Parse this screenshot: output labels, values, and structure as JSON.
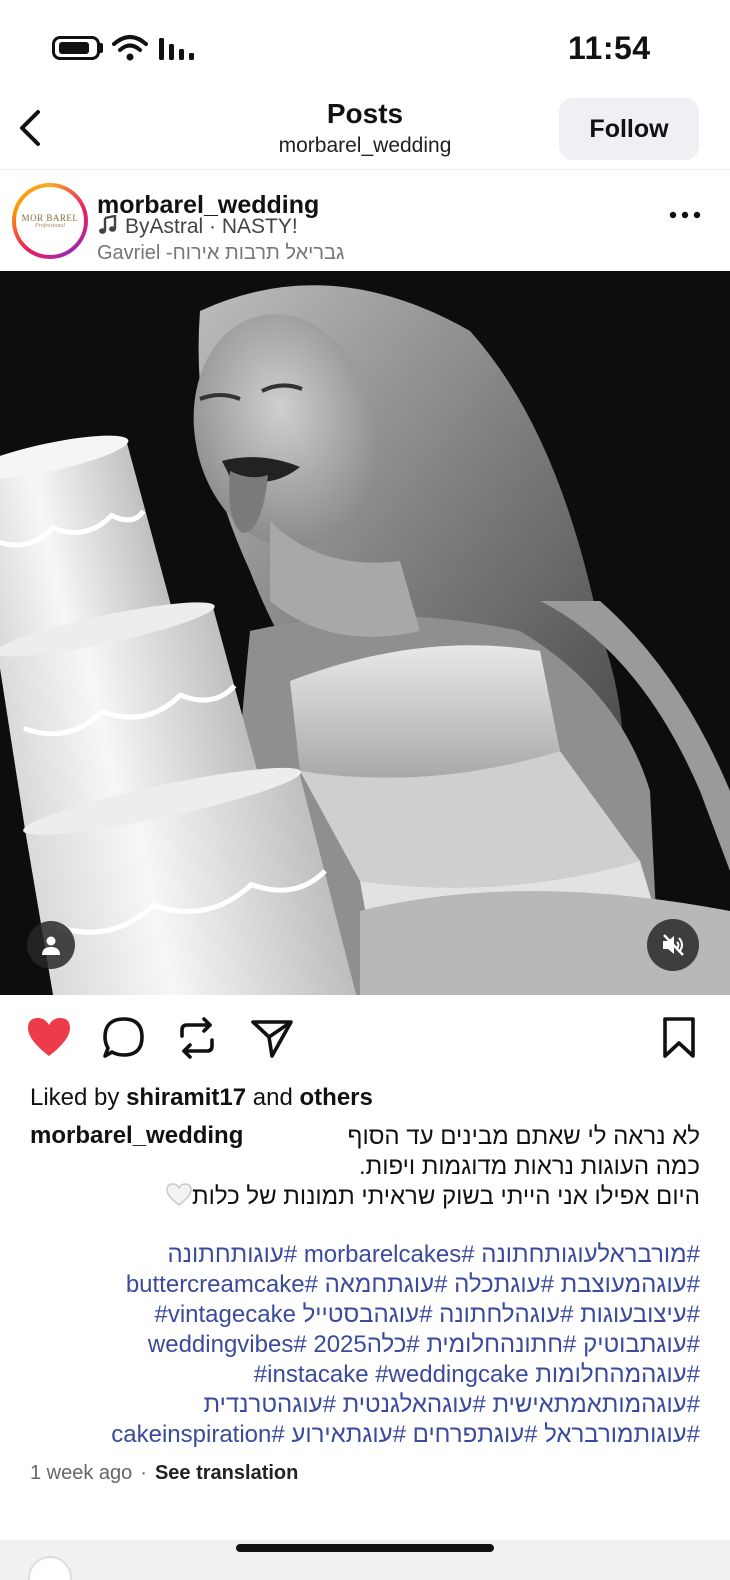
{
  "status_bar": {
    "time": "11:54"
  },
  "nav": {
    "title": "Posts",
    "subtitle": "morbarel_wedding",
    "follow_label": "Follow"
  },
  "post": {
    "username": "morbarel_wedding",
    "avatar_text": "MOR BAREL",
    "avatar_subtext": "Professional",
    "audio": "ByAstral · NASTY!",
    "location": "Gavriel -גבריאל תרבות אירוח"
  },
  "actions": {
    "liked": true,
    "like_color": "#ed3b4c"
  },
  "likes": {
    "prefix": "Liked by",
    "user": "shiramit17",
    "and": "and",
    "others": "others"
  },
  "caption": {
    "user": "morbarel_wedding",
    "lines": [
      "לא נראה לי שאתם מבינים עד הסוף",
      "כמה העוגות נראות מדוגמות ויפות.",
      "היום אפילו אני הייתי בשוק שראיתי תמונות של כלות"
    ]
  },
  "hashtags": [
    "#מורבראלעוגותחתונה #morbarelcakes #עוגותחתונה",
    "#עוגהמעוצבת #עוגתכלה #עוגתחמאה #buttercreamcake",
    "#עוגתבוטיק #חתונהחלומית #כלה2025 #weddingvibes",
    "#עוגהמותאמתאישית #עוגהאלגנטית #עוגהטרנדית",
    "#עוגותמורבראל #עוגתפרחים #עוגתאירוע #cakeinspiration"
  ],
  "hashtags_mixed": {
    "line3": {
      "a": "#עיצובעוגות #עוגהלחתונה #עוגהבסטייל",
      "b": "#vintagecake"
    },
    "line5": {
      "a": "#עוגהמהחלומות",
      "b": "#instacake #weddingcake"
    }
  },
  "meta": {
    "age": "1 week ago",
    "separator": "·",
    "translate": "See translation"
  },
  "colors": {
    "hashtag": "#3b4a9c",
    "follow_bg": "#efeff4"
  }
}
